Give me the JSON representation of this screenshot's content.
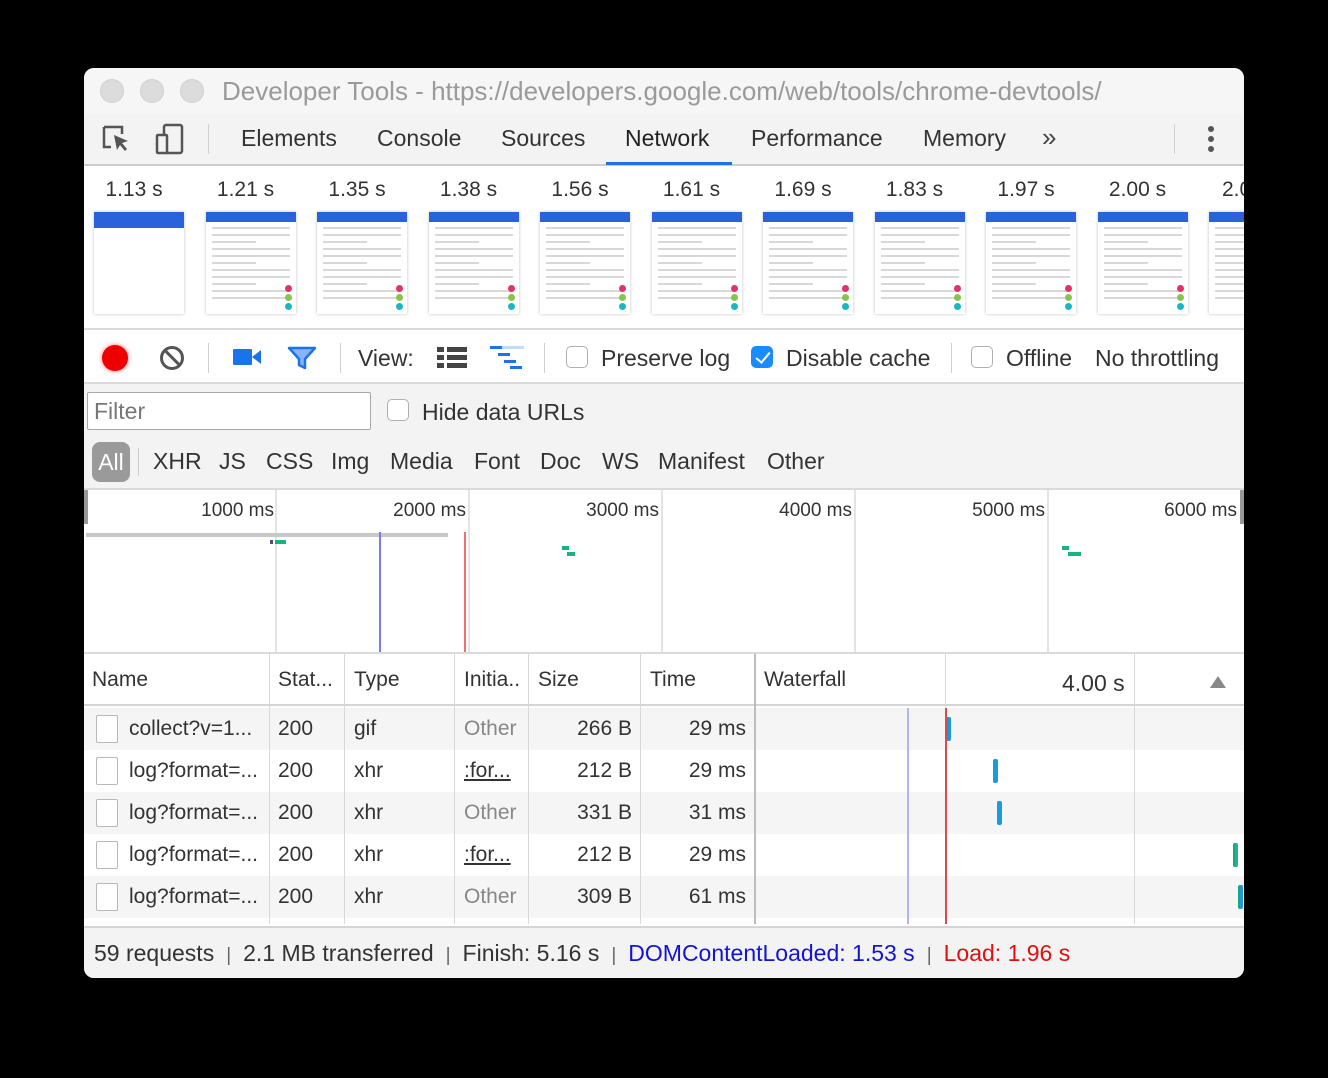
{
  "window": {
    "title": "Developer Tools - https://developers.google.com/web/tools/chrome-devtools/"
  },
  "tabs": [
    {
      "label": "Elements",
      "active": false
    },
    {
      "label": "Console",
      "active": false
    },
    {
      "label": "Sources",
      "active": false
    },
    {
      "label": "Network",
      "active": true
    },
    {
      "label": "Performance",
      "active": false
    },
    {
      "label": "Memory",
      "active": false
    }
  ],
  "tabbar": {
    "more_tabs_glyph": "»",
    "icons": [
      "inspect-element-icon",
      "device-toolbar-icon",
      "more-tabs-icon",
      "kebab-menu-icon"
    ]
  },
  "filmstrip": {
    "frames": [
      "1.13 s",
      "1.21 s",
      "1.35 s",
      "1.38 s",
      "1.56 s",
      "1.61 s",
      "1.69 s",
      "1.83 s",
      "1.97 s",
      "2.00 s",
      "2.0"
    ]
  },
  "toolbar": {
    "view_label": "View:",
    "preserve_log": {
      "label": "Preserve log",
      "checked": false
    },
    "disable_cache": {
      "label": "Disable cache",
      "checked": true
    },
    "offline": {
      "label": "Offline",
      "checked": false
    },
    "throttling": "No throttling",
    "record_color": "#e00000",
    "accent_color": "#1a73e8"
  },
  "filter": {
    "placeholder": "Filter",
    "value": "",
    "hide_data_urls": {
      "label": "Hide data URLs",
      "checked": false
    },
    "types": [
      "All",
      "XHR",
      "JS",
      "CSS",
      "Img",
      "Media",
      "Font",
      "Doc",
      "WS",
      "Manifest",
      "Other"
    ],
    "active_type": "All"
  },
  "overview": {
    "ticks": [
      "1000 ms",
      "2000 ms",
      "3000 ms",
      "4000 ms",
      "5000 ms",
      "6000 ms"
    ],
    "dom_content_loaded_ms": 1530,
    "load_ms": 1960
  },
  "table": {
    "columns": [
      "Name",
      "Stat...",
      "Type",
      "Initia..",
      "Size",
      "Time",
      "Waterfall"
    ],
    "waterfall_scale_label": "4.00 s",
    "sort_direction": "ascending",
    "rows": [
      {
        "name": "collect?v=1...",
        "status": "200",
        "type": "gif",
        "initiator": "Other",
        "initiator_link": false,
        "size": "266 B",
        "time": "29 ms"
      },
      {
        "name": "log?format=...",
        "status": "200",
        "type": "xhr",
        "initiator": ":for...",
        "initiator_link": true,
        "size": "212 B",
        "time": "29 ms"
      },
      {
        "name": "log?format=...",
        "status": "200",
        "type": "xhr",
        "initiator": "Other",
        "initiator_link": false,
        "size": "331 B",
        "time": "31 ms"
      },
      {
        "name": "log?format=...",
        "status": "200",
        "type": "xhr",
        "initiator": ":for...",
        "initiator_link": true,
        "size": "212 B",
        "time": "29 ms"
      },
      {
        "name": "log?format=...",
        "status": "200",
        "type": "xhr",
        "initiator": "Other",
        "initiator_link": false,
        "size": "309 B",
        "time": "61 ms"
      }
    ]
  },
  "summary": {
    "requests": "59 requests",
    "transferred": "2.1 MB transferred",
    "finish": "Finish: 5.16 s",
    "dom_content_loaded": "DOMContentLoaded: 1.53 s",
    "load": "Load: 1.96 s",
    "separator": "|"
  }
}
